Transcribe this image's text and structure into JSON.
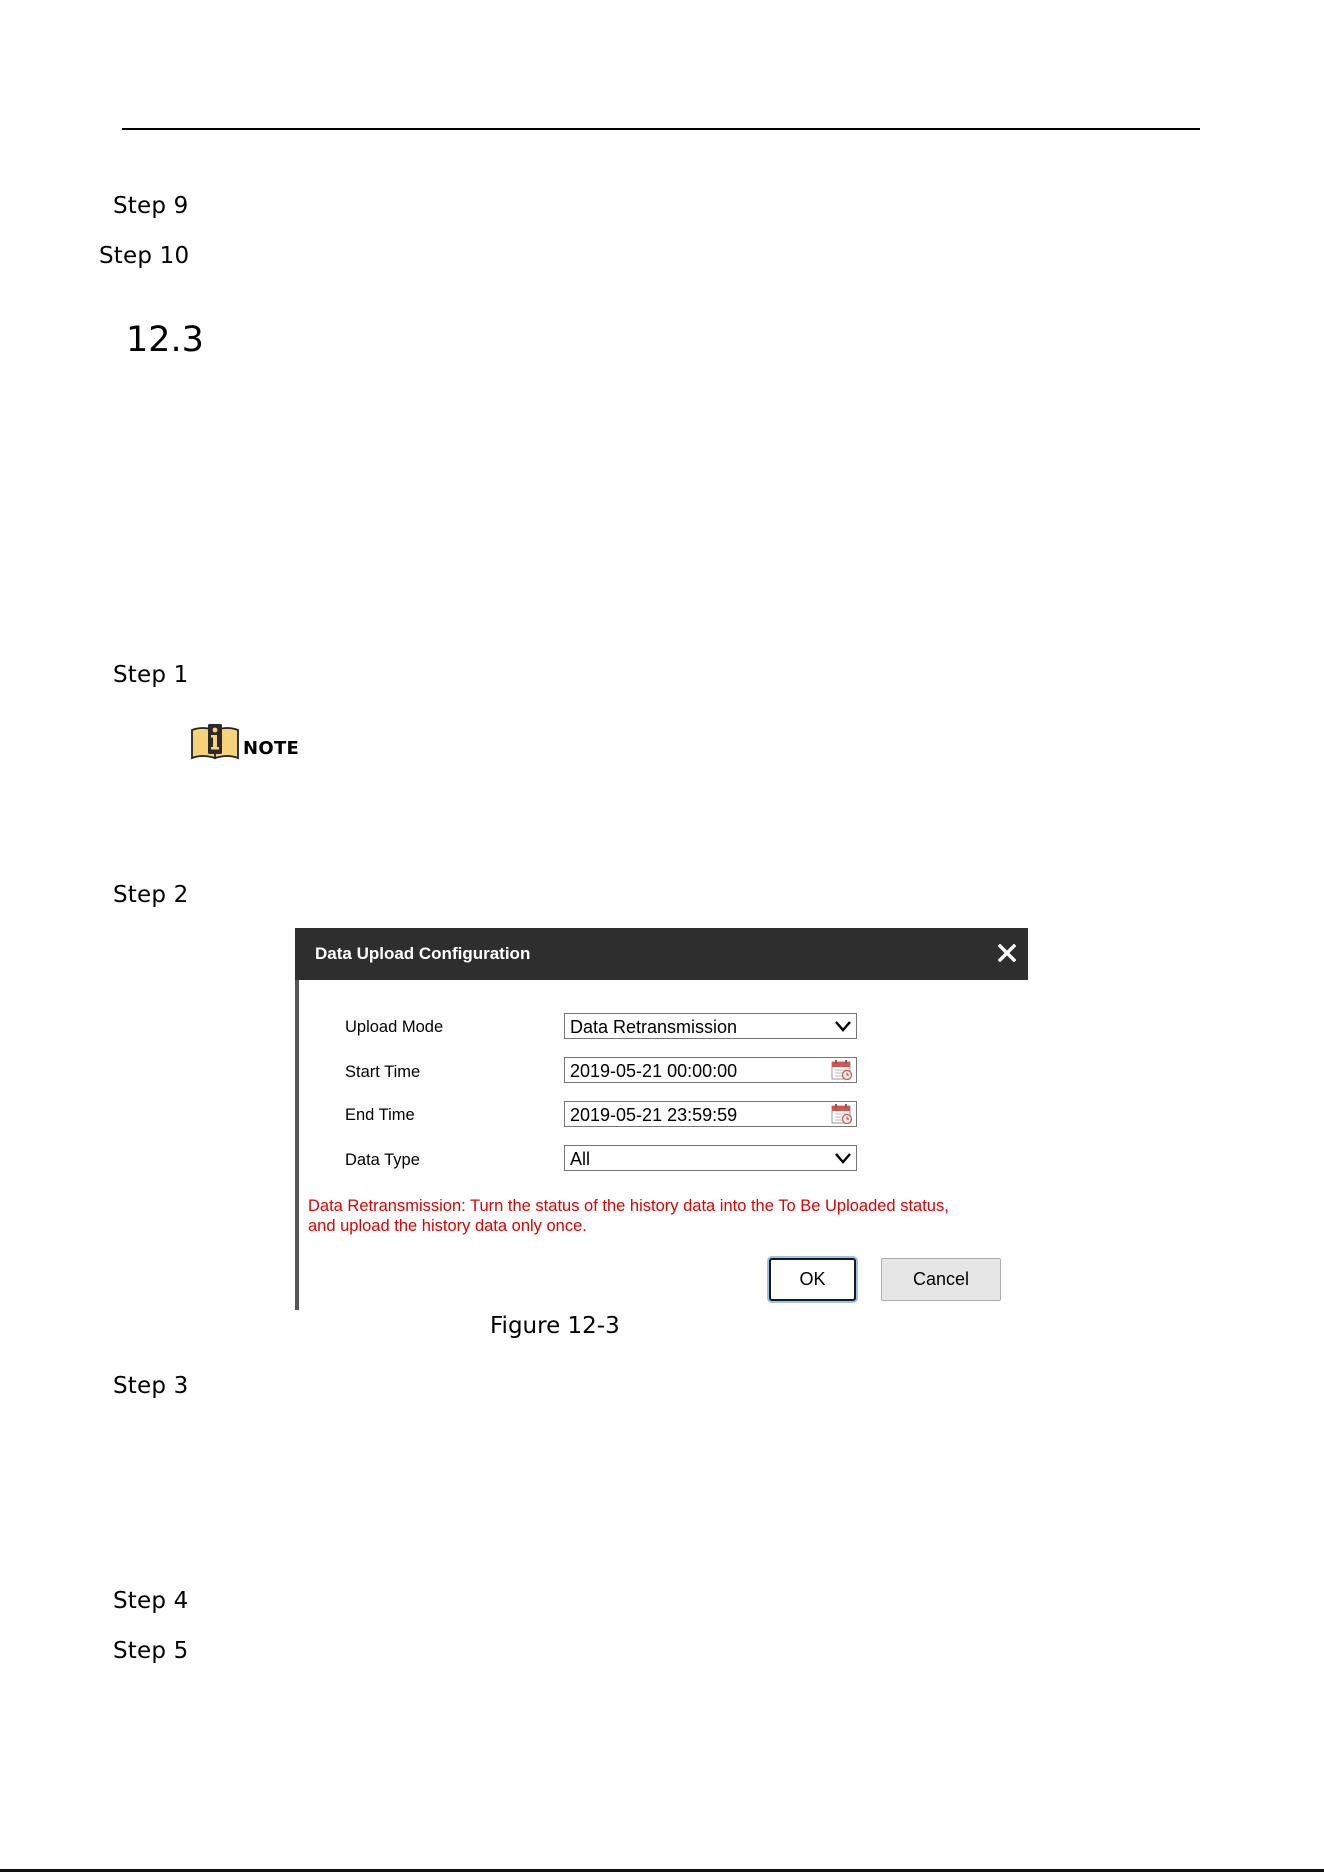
{
  "section": {
    "number": "12.3"
  },
  "steps": {
    "step9": "Step 9",
    "step10": "Step 10",
    "step1": "Step 1",
    "step2": "Step 2",
    "step3": "Step 3",
    "step4": "Step 4",
    "step5": "Step 5"
  },
  "note": {
    "label": "NOTE",
    "icon": "info-book-icon"
  },
  "dialog": {
    "title": "Data Upload Configuration",
    "close_icon": "close-icon",
    "fields": {
      "upload_mode": {
        "label": "Upload Mode",
        "value": "Data Retransmission"
      },
      "start_time": {
        "label": "Start Time",
        "value": "2019-05-21 00:00:00"
      },
      "end_time": {
        "label": "End Time",
        "value": "2019-05-21 23:59:59"
      },
      "data_type": {
        "label": "Data Type",
        "value": "All"
      }
    },
    "hint_line1": "Data Retransmission: Turn the status of the history data into the To Be Uploaded status,",
    "hint_line2": "and upload the history data only once.",
    "ok_label": "OK",
    "cancel_label": "Cancel",
    "colors": {
      "header_bg": "#2e2e2e",
      "hint_text": "#e00000",
      "ok_focus_ring": "#9ec1ec"
    }
  },
  "figure": {
    "caption": "Figure 12-3"
  }
}
